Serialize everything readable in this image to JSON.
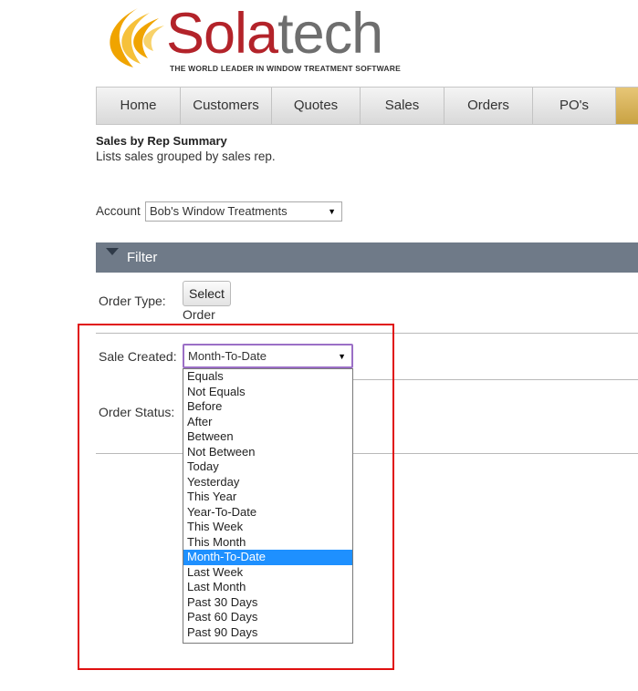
{
  "logo": {
    "brand_a": "Sola",
    "brand_b": "tech",
    "tagline": "THE WORLD LEADER IN WINDOW TREATMENT SOFTWARE"
  },
  "nav": [
    "Home",
    "Customers",
    "Quotes",
    "Sales",
    "Orders",
    "PO's"
  ],
  "page": {
    "title": "Sales by Rep Summary",
    "subtitle": "Lists sales grouped by sales rep."
  },
  "account": {
    "label": "Account",
    "value": "Bob's Window Treatments"
  },
  "filter": {
    "label": "Filter",
    "order_type_label": "Order Type:",
    "select_button": "Select",
    "order_word": "Order",
    "sale_created_label": "Sale Created:",
    "sale_created_value": "Month-To-Date",
    "order_status_label": "Order Status:"
  },
  "dropdown_options": [
    "Equals",
    "Not Equals",
    "Before",
    "After",
    "Between",
    "Not Between",
    "Today",
    "Yesterday",
    "This Year",
    "Year-To-Date",
    "This Week",
    "This Month",
    "Month-To-Date",
    "Last Week",
    "Last Month",
    "Past 30 Days",
    "Past 60 Days",
    "Past 90 Days"
  ],
  "selected_option": "Month-To-Date",
  "colors": {
    "brand_red": "#b3232a",
    "filter_bar": "#6f7a88",
    "highlight": "#1e90ff",
    "annotation_red": "#e01010"
  }
}
